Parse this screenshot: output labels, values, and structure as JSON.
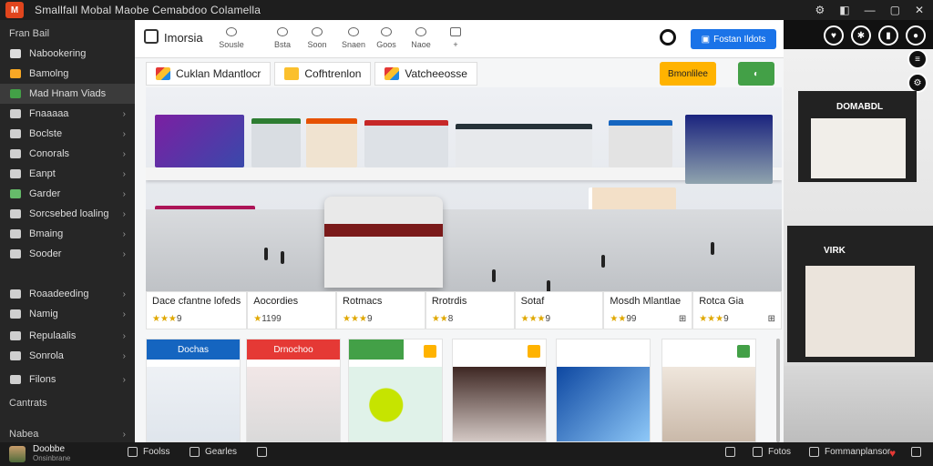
{
  "window": {
    "title": "Smallfall Mobal Maobe  Cemabdoo  Colamella",
    "controls": [
      "⚙",
      "◧",
      "—",
      "▢",
      "✕"
    ]
  },
  "sidebar": {
    "top_label": "Fran Bail",
    "items": [
      {
        "label": "Nabookering",
        "chevron": ""
      },
      {
        "label": "Bamolng",
        "chevron": ""
      },
      {
        "label": "Mad Hnam Viads",
        "chevron": "",
        "active": true
      },
      {
        "label": "Fnaaaaa",
        "chevron": "›"
      },
      {
        "label": "Boclste",
        "chevron": "›"
      },
      {
        "label": "Conorals",
        "chevron": "›"
      },
      {
        "label": "Eanpt",
        "chevron": "›"
      },
      {
        "label": "Garder",
        "chevron": "›"
      },
      {
        "label": "Sorcsebed loaling",
        "chevron": "›"
      },
      {
        "label": "Bmaing",
        "chevron": "›"
      },
      {
        "label": "Sooder",
        "chevron": "›"
      },
      {
        "label": "Roaadeeding",
        "chevron": "›"
      },
      {
        "label": "Namig",
        "chevron": "›"
      },
      {
        "label": "Repulaalis",
        "chevron": "›"
      },
      {
        "label": "Sonrola",
        "chevron": "›"
      },
      {
        "label": "Filons",
        "chevron": "›"
      }
    ],
    "section_heading": "Cantrats",
    "footer_item": {
      "label": "Nabea",
      "chevron": "›"
    }
  },
  "toolbar": {
    "brand": "Imorsia",
    "tools": [
      "Sousle",
      "Bsta",
      "Soon",
      "Snaen",
      "Goos",
      "Naoe",
      "+"
    ],
    "primary_button": "Fostan Ildots"
  },
  "tabs": [
    {
      "label": "Cuklan Mdantlocr"
    },
    {
      "label": "Cofhtrenlon"
    },
    {
      "label": "Vatcheeosse"
    }
  ],
  "pills": {
    "orange": "Bmonlilee",
    "green": "◐"
  },
  "cards": [
    {
      "title": "Dace cfantne lofeds",
      "rating": "★★★",
      "score": "9",
      "action": ""
    },
    {
      "title": "Aocordies",
      "rating": "★",
      "score": "1199",
      "action": ""
    },
    {
      "title": "Rotmacs",
      "rating": "★★★",
      "score": "9",
      "action": ""
    },
    {
      "title": "Rrotrdis",
      "rating": "★★",
      "score": "8",
      "action": ""
    },
    {
      "title": "Sotaf",
      "rating": "★★★",
      "score": "9",
      "action": ""
    },
    {
      "title": "Mosdh Mlantlae",
      "rating": "★★",
      "score": "99",
      "action": "⊞"
    },
    {
      "title": "Rotca Gia",
      "rating": "★★★",
      "score": "9",
      "action": "⊞"
    }
  ],
  "promos": [
    {
      "head": "Dochas",
      "head_color": "#1565c0"
    },
    {
      "head": "Drnochoo",
      "head_color": "#e53935"
    },
    {
      "head": "",
      "head_color": "#43a047"
    },
    {
      "head": "",
      "head_color": "#ffffff"
    },
    {
      "head": "",
      "head_color": "#ffffff"
    },
    {
      "head": "",
      "head_color": "#ffffff"
    }
  ],
  "right_pane": {
    "sign_top": "DOMABDL",
    "sign_bottom": "VIRK"
  },
  "bottombar": {
    "user_name": "Doobbe",
    "user_sub": "Onsinbrane",
    "left_items": [
      "Foolss",
      "Gearles"
    ],
    "right_items": [
      "Fotos",
      "Fommanplansor"
    ]
  },
  "colors": {
    "accent_blue": "#1a73e8",
    "sidebar_bg": "#262626",
    "pill_orange": "#ffb300",
    "pill_green": "#43a047"
  }
}
